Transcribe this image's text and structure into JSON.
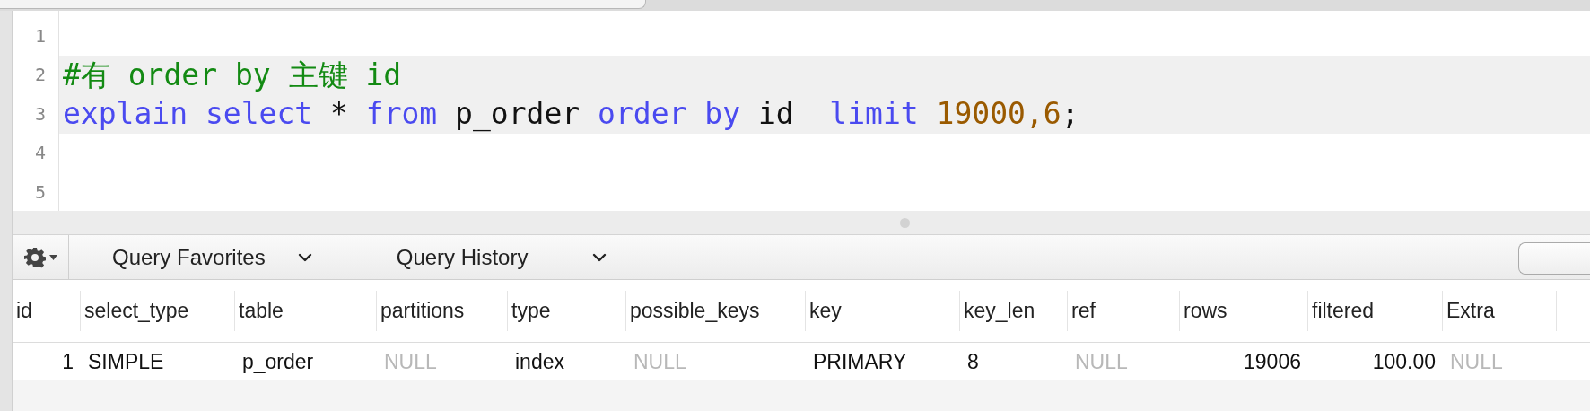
{
  "editor": {
    "lines": [
      {
        "number": "1",
        "highlighted": false
      },
      {
        "number": "2",
        "highlighted": true,
        "tokens": [
          {
            "kind": "comment",
            "text": "#有 order by 主键 id"
          }
        ]
      },
      {
        "number": "3",
        "highlighted": true,
        "tokens": [
          {
            "kind": "keyword",
            "text": "explain select"
          },
          {
            "kind": "plain",
            "text": " * "
          },
          {
            "kind": "keyword",
            "text": "from"
          },
          {
            "kind": "plain",
            "text": " p_order "
          },
          {
            "kind": "keyword",
            "text": "order by"
          },
          {
            "kind": "plain",
            "text": " id  "
          },
          {
            "kind": "keyword",
            "text": "limit"
          },
          {
            "kind": "number",
            "text": " 19000,6"
          },
          {
            "kind": "plain",
            "text": ";"
          }
        ]
      },
      {
        "number": "4",
        "highlighted": false
      },
      {
        "number": "5",
        "highlighted": false
      }
    ]
  },
  "toolbar": {
    "favorites": "Query Favorites",
    "history": "Query History"
  },
  "results": {
    "columns": [
      {
        "label": "id",
        "kind": "number"
      },
      {
        "label": "select_type",
        "kind": "text"
      },
      {
        "label": "table",
        "kind": "text"
      },
      {
        "label": "partitions",
        "kind": "text"
      },
      {
        "label": "type",
        "kind": "text"
      },
      {
        "label": "possible_keys",
        "kind": "text"
      },
      {
        "label": "key",
        "kind": "text"
      },
      {
        "label": "key_len",
        "kind": "text"
      },
      {
        "label": "ref",
        "kind": "text"
      },
      {
        "label": "rows",
        "kind": "number"
      },
      {
        "label": "filtered",
        "kind": "number"
      },
      {
        "label": "Extra",
        "kind": "text"
      }
    ],
    "rows": [
      [
        {
          "text": "1",
          "null": false
        },
        {
          "text": "SIMPLE",
          "null": false
        },
        {
          "text": "p_order",
          "null": false
        },
        {
          "text": "NULL",
          "null": true
        },
        {
          "text": "index",
          "null": false
        },
        {
          "text": "NULL",
          "null": true
        },
        {
          "text": "PRIMARY",
          "null": false
        },
        {
          "text": "8",
          "null": false
        },
        {
          "text": "NULL",
          "null": true
        },
        {
          "text": "19006",
          "null": false
        },
        {
          "text": "100.00",
          "null": false
        },
        {
          "text": "NULL",
          "null": true
        }
      ]
    ]
  }
}
